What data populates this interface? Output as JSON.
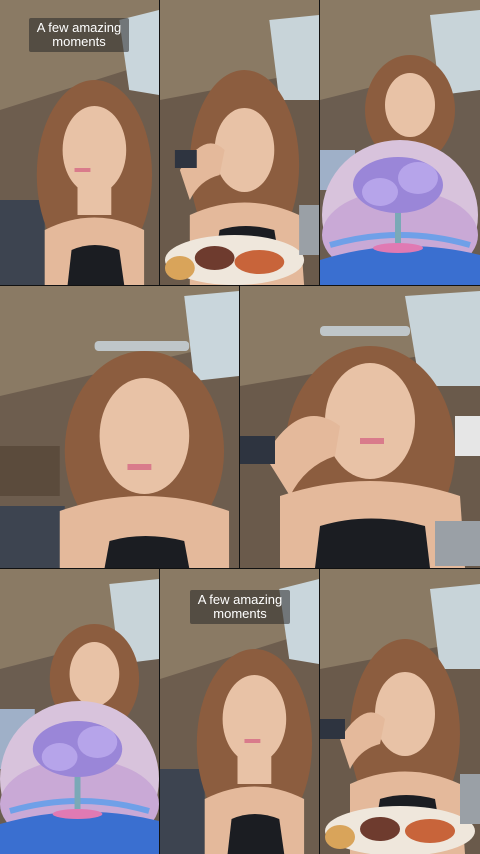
{
  "captions": {
    "top": "A few amazing\nmoments",
    "bottom": "A few amazing\nmoments"
  },
  "colors": {
    "canopy": "#8a7a64",
    "hair": "#8c5d3f",
    "skin": "#e8c2a6",
    "top": "#1b1d22",
    "tree_leaves": "#9a86d8",
    "water": "#3a6fd0"
  },
  "tiles": [
    {
      "name": "tile-1-woman-talking",
      "scene": "talking"
    },
    {
      "name": "tile-2-woman-hand-on-face-with-food",
      "scene": "resting-food"
    },
    {
      "name": "tile-3-tree-filter",
      "scene": "tree-filter"
    },
    {
      "name": "tile-4-woman-talking-large",
      "scene": "talking"
    },
    {
      "name": "tile-5-woman-hand-on-face-large",
      "scene": "resting"
    },
    {
      "name": "tile-6-tree-filter",
      "scene": "tree-filter"
    },
    {
      "name": "tile-7-woman-talking",
      "scene": "talking"
    },
    {
      "name": "tile-8-woman-hand-on-face-with-food",
      "scene": "resting-food"
    }
  ]
}
